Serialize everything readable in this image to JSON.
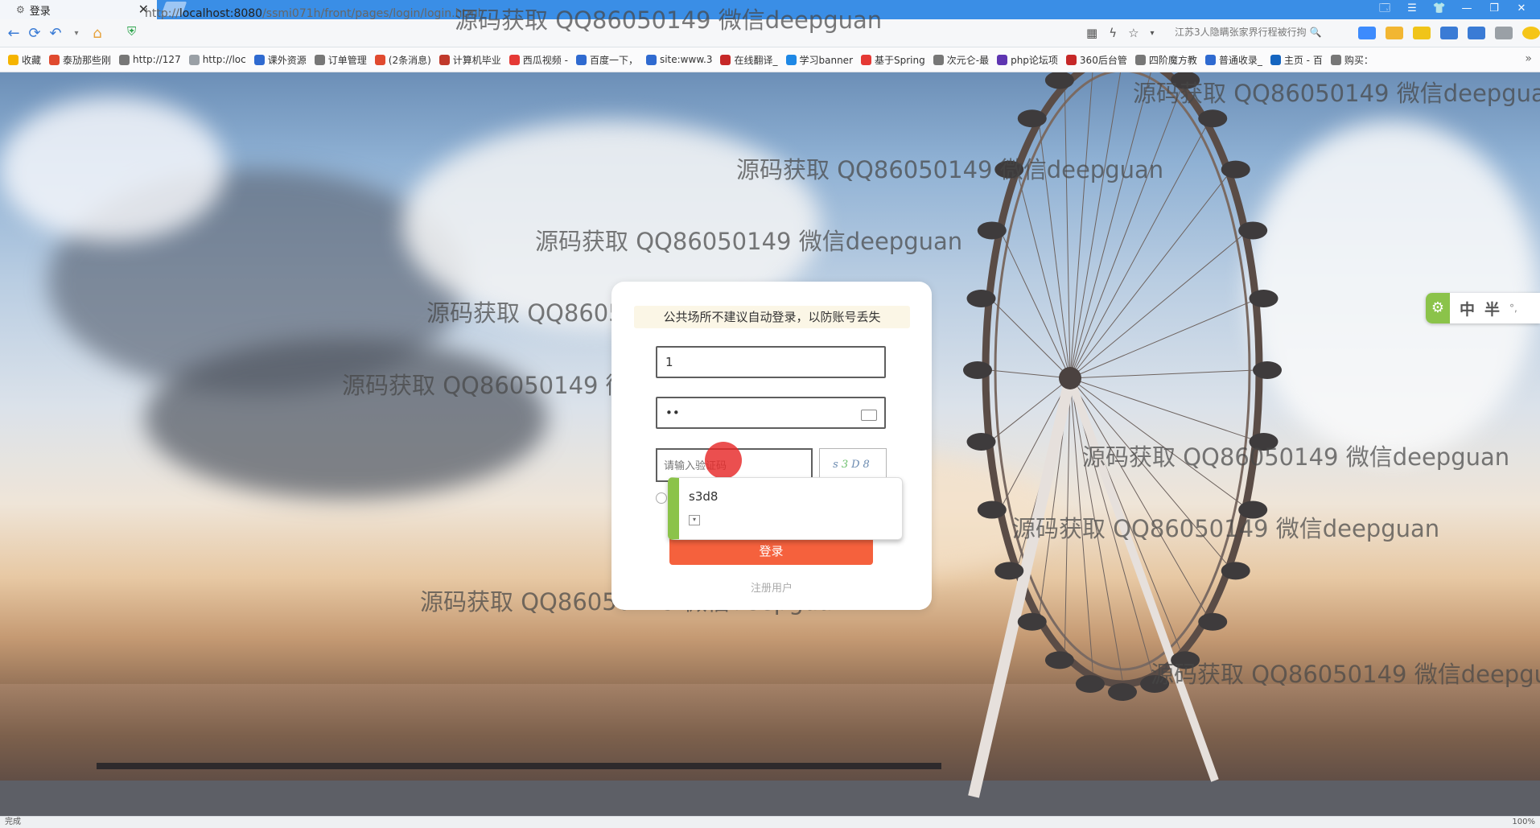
{
  "browser": {
    "tab_title": "登录",
    "url_prefix": "http://",
    "url_host": "localhost:8080",
    "url_path": "/ssmi071h/front/pages/login/login.html",
    "search_text": "江苏3人隐瞒张家界行程被行拘",
    "window_controls": [
      "🗔",
      "☰",
      "👕",
      "—",
      "❐",
      "✕"
    ]
  },
  "bookmarks": [
    {
      "label": "收藏",
      "color": "#f5b400"
    },
    {
      "label": "泰劢那些刚",
      "color": "#e04a2f"
    },
    {
      "label": "http://127",
      "color": "#777777"
    },
    {
      "label": "http://loc",
      "color": "#9aa0a6"
    },
    {
      "label": "课外资源",
      "color": "#2f6ad0"
    },
    {
      "label": "订单管理",
      "color": "#777777"
    },
    {
      "label": "(2条消息)",
      "color": "#e04a2f"
    },
    {
      "label": "计算机毕业",
      "color": "#c0392b"
    },
    {
      "label": "西瓜视频 -",
      "color": "#e53935"
    },
    {
      "label": "百度一下，",
      "color": "#2f6ad0"
    },
    {
      "label": "site:www.3",
      "color": "#2f6ad0"
    },
    {
      "label": "在线翻译_",
      "color": "#c62828"
    },
    {
      "label": "学习banner",
      "color": "#1e88e5"
    },
    {
      "label": "基于Spring",
      "color": "#e53935"
    },
    {
      "label": "次元仑-最",
      "color": "#777777"
    },
    {
      "label": "php论坛项",
      "color": "#5e35b1"
    },
    {
      "label": "360后台管",
      "color": "#c62828"
    },
    {
      "label": "四阶魔方教",
      "color": "#777777"
    },
    {
      "label": "普通收录_",
      "color": "#2f6ad0"
    },
    {
      "label": "主页 - 百",
      "color": "#1565c0"
    },
    {
      "label": "购买：",
      "color": "#777777"
    }
  ],
  "watermark_text": "源码获取 QQ86050149 微信deepguan",
  "login": {
    "notice": "公共场所不建议自动登录，以防账号丢失",
    "username_value": "1",
    "password_value": "••",
    "captcha_placeholder": "请输入验证码",
    "captcha_chars": [
      "s",
      "3",
      "D",
      "8"
    ],
    "autocomplete_value": "s3d8",
    "login_button": "登录",
    "register_link": "注册用户"
  },
  "ime": {
    "items": [
      "中",
      "半",
      "°,"
    ]
  },
  "status": {
    "left": "完成",
    "right": "100%"
  },
  "colors": {
    "accent_button": "#f5613d",
    "ime_green": "#8bc34a",
    "titlebar": "#3a8ee6"
  }
}
